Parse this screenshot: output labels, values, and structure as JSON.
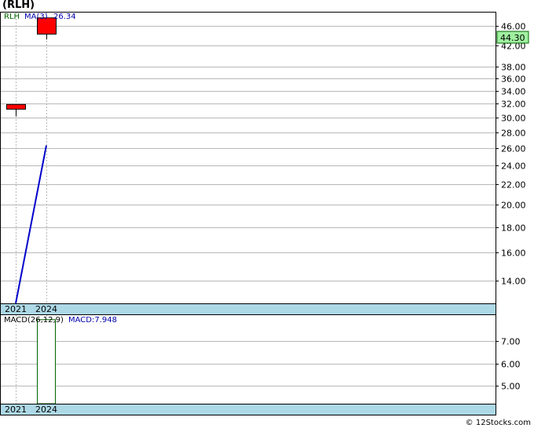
{
  "page": {
    "title": "(RLH)",
    "footer": "© 12Stocks.com"
  },
  "colors": {
    "candle_down": "#ff0000",
    "ma_line": "#0000cc",
    "grid": "#b8b8b8",
    "axis_band": "#add8e6",
    "last_price_bg": "#a0f0a0",
    "macd_bar_stroke": "#006400",
    "legend_ticker": "#006400",
    "legend_ma": "#0000aa"
  },
  "chart_data": [
    {
      "type": "candlestick",
      "ticker_label": "RLH",
      "ma_label": "MA(3)",
      "ma_value_label": "26.34",
      "last_price_label": "44.30",
      "x_ticks": [
        "2021",
        "2024"
      ],
      "y_ticks": [
        "14.00",
        "16.00",
        "18.00",
        "20.00",
        "22.00",
        "24.00",
        "26.00",
        "28.00",
        "30.00",
        "32.00",
        "34.00",
        "36.00",
        "38.00",
        "42.00",
        "46.00"
      ],
      "ylim": [
        12.6,
        49.0
      ],
      "scale": "log",
      "candles": [
        {
          "x": "2021",
          "open": 31.9,
          "high": 31.9,
          "low": 30.2,
          "close": 31.2
        },
        {
          "x": "2024",
          "open": 47.8,
          "high": 47.8,
          "low": 43.2,
          "close": 44.3
        }
      ],
      "ma_series": {
        "name": "MA(3)",
        "points": [
          {
            "x": "2021",
            "y": 12.6
          },
          {
            "x": "2024",
            "y": 26.34
          }
        ]
      }
    },
    {
      "type": "bar",
      "label": "MACD(26,12,9)",
      "value_label": "MACD:7.948",
      "x_ticks": [
        "2021",
        "2024"
      ],
      "y_ticks": [
        "5.00",
        "6.00",
        "7.00"
      ],
      "ylim": [
        4.2,
        8.15
      ],
      "bars": [
        {
          "x": "2024",
          "value": 7.948
        }
      ]
    }
  ]
}
